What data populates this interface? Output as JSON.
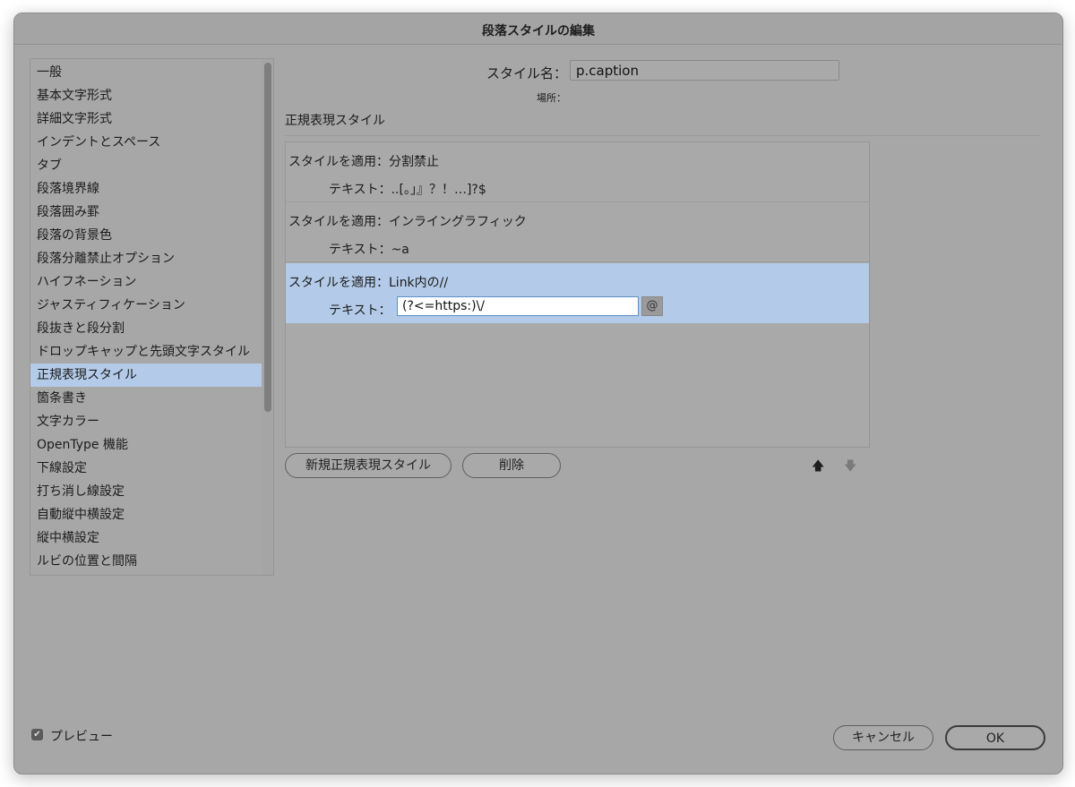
{
  "window": {
    "title": "段落スタイルの編集"
  },
  "sidebar": {
    "items": [
      {
        "label": "一般"
      },
      {
        "label": "基本文字形式"
      },
      {
        "label": "詳細文字形式"
      },
      {
        "label": "インデントとスペース"
      },
      {
        "label": "タブ"
      },
      {
        "label": "段落境界線"
      },
      {
        "label": "段落囲み罫"
      },
      {
        "label": "段落の背景色"
      },
      {
        "label": "段落分離禁止オプション"
      },
      {
        "label": "ハイフネーション"
      },
      {
        "label": "ジャスティフィケーション"
      },
      {
        "label": "段抜きと段分割"
      },
      {
        "label": "ドロップキャップと先頭文字スタイル"
      },
      {
        "label": "正規表現スタイル",
        "selected": true
      },
      {
        "label": "箇条書き"
      },
      {
        "label": "文字カラー"
      },
      {
        "label": "OpenType 機能"
      },
      {
        "label": "下線設定"
      },
      {
        "label": "打ち消し線設定"
      },
      {
        "label": "自動縦中横設定"
      },
      {
        "label": "縦中横設定"
      },
      {
        "label": "ルビの位置と間隔"
      }
    ]
  },
  "style_name": {
    "label": "スタイル名：",
    "value": "p.caption"
  },
  "location": {
    "label": "場所："
  },
  "section": {
    "title": "正規表現スタイル"
  },
  "rules": [
    {
      "style_label": "スタイルを適用：分割禁止",
      "text_label": "テキスト：..[。」』？！…]?$"
    },
    {
      "style_label": "スタイルを適用：インライングラフィック",
      "text_label": "テキスト：~a"
    },
    {
      "style_label": "スタイルを適用：Link内の//",
      "text_label": "テキスト：",
      "text_value": "(?<=https:)\\/",
      "selected": true
    }
  ],
  "buttons": {
    "new_rule": "新規正規表現スタイル",
    "delete": "削除",
    "up_arrow": "🡅",
    "down_arrow": "🡇",
    "at_symbol": "@",
    "cancel": "キャンセル",
    "ok": "OK"
  },
  "preview": {
    "label": "プレビュー",
    "checked": true,
    "check_mark": "✔"
  },
  "colors": {
    "selection": "#b3cbe8",
    "window_bg": "#a7a7a7"
  }
}
